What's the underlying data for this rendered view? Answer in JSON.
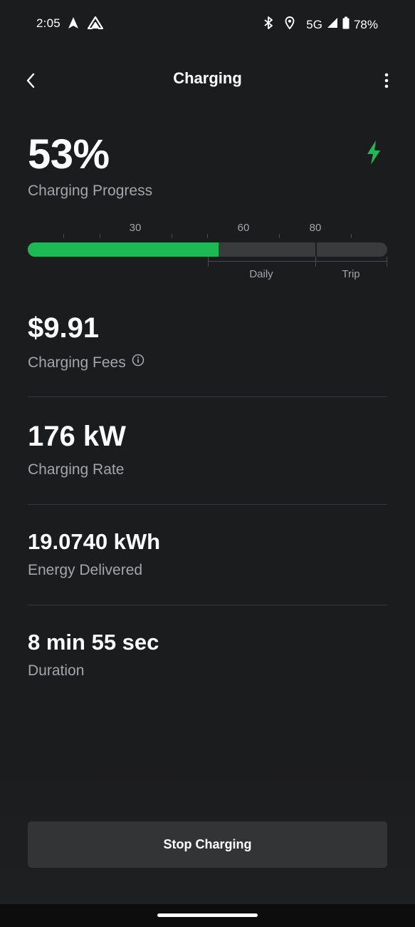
{
  "status_bar": {
    "time": "2:05",
    "network": "5G",
    "battery": "78%",
    "icons": [
      "navigation-arrow-icon",
      "android-auto-icon",
      "bluetooth-icon",
      "location-icon",
      "signal-icon",
      "battery-icon"
    ]
  },
  "header": {
    "title": "Charging",
    "back_icon": "chevron-left-icon",
    "menu_icon": "more-vertical-icon"
  },
  "progress": {
    "percent_text": "53%",
    "label": "Charging Progress",
    "fill_percent": 53,
    "charge_limit_percent": 80,
    "scale_labels": [
      "30",
      "60",
      "80"
    ],
    "ranges": [
      "Daily",
      "Trip"
    ],
    "status_icon": "bolt-icon",
    "accent_color": "#1db954"
  },
  "metrics": {
    "fees": {
      "value": "$9.91",
      "label": "Charging Fees",
      "icon": "info-icon"
    },
    "rate": {
      "value": "176 kW",
      "label": "Charging Rate"
    },
    "energy": {
      "value": "19.0740 kWh",
      "label": "Energy Delivered"
    },
    "duration": {
      "value": "8 min 55 sec",
      "label": "Duration"
    }
  },
  "actions": {
    "stop_label": "Stop Charging"
  }
}
